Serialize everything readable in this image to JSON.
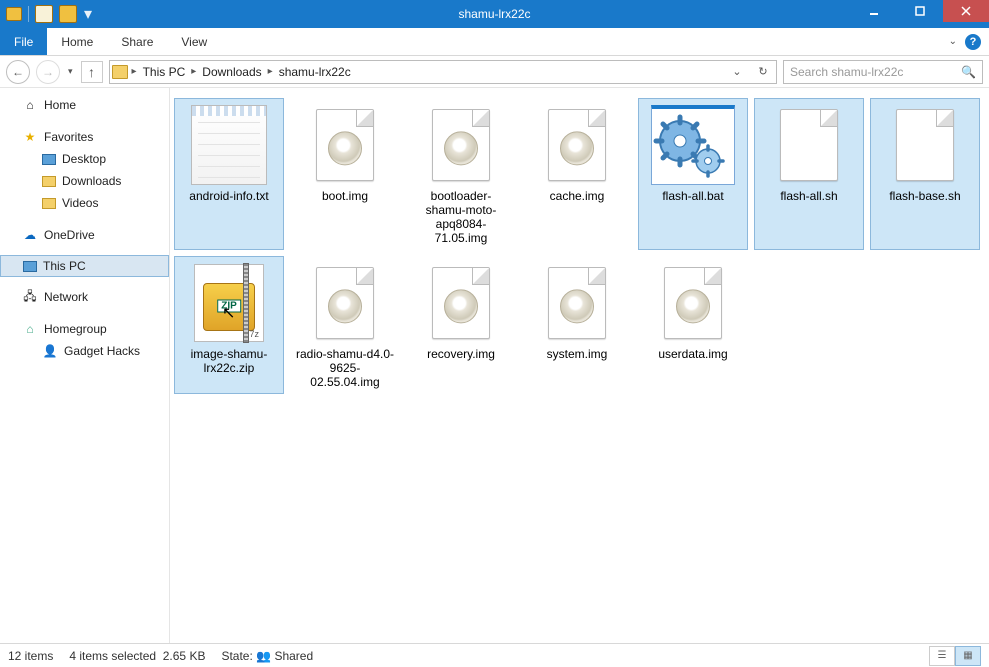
{
  "window": {
    "title": "shamu-lrx22c"
  },
  "ribbon": {
    "file": "File",
    "tabs": [
      "Home",
      "Share",
      "View"
    ]
  },
  "breadcrumb": {
    "items": [
      "This PC",
      "Downloads",
      "shamu-lrx22c"
    ]
  },
  "search": {
    "placeholder": "Search shamu-lrx22c"
  },
  "nav": {
    "home": "Home",
    "favorites": {
      "label": "Favorites",
      "items": [
        "Desktop",
        "Downloads",
        "Videos"
      ]
    },
    "onedrive": "OneDrive",
    "thispc": "This PC",
    "network": "Network",
    "homegroup": {
      "label": "Homegroup",
      "items": [
        "Gadget Hacks"
      ]
    }
  },
  "files": [
    {
      "name": "android-info.txt",
      "type": "txt",
      "selected": true
    },
    {
      "name": "boot.img",
      "type": "img",
      "selected": false
    },
    {
      "name": "bootloader-shamu-moto-apq8084-71.05.img",
      "type": "img",
      "selected": false
    },
    {
      "name": "cache.img",
      "type": "img",
      "selected": false
    },
    {
      "name": "flash-all.bat",
      "type": "bat",
      "selected": true
    },
    {
      "name": "flash-all.sh",
      "type": "blank",
      "selected": true
    },
    {
      "name": "flash-base.sh",
      "type": "blank",
      "selected": true
    },
    {
      "name": "image-shamu-lrx22c.zip",
      "type": "zip",
      "selected": true,
      "focused": true
    },
    {
      "name": "radio-shamu-d4.0-9625-02.55.04.img",
      "type": "img",
      "selected": false
    },
    {
      "name": "recovery.img",
      "type": "img",
      "selected": false
    },
    {
      "name": "system.img",
      "type": "img",
      "selected": false
    },
    {
      "name": "userdata.img",
      "type": "img",
      "selected": false
    }
  ],
  "status": {
    "count": "12 items",
    "selection": "4 items selected",
    "size": "2.65 KB",
    "state_label": "State:",
    "state_value": "Shared"
  }
}
